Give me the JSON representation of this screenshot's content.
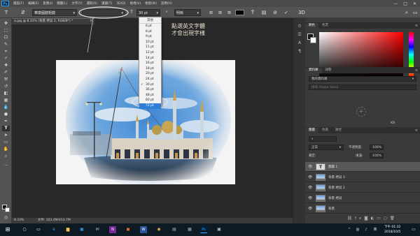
{
  "menubar": {
    "items": [
      "檔案(F)",
      "編輯(E)",
      "影像(I)",
      "圖層(L)",
      "文字(Y)",
      "選取(S)",
      "濾鏡(T)",
      "3D(D)",
      "檢視(V)",
      "視窗(W)",
      "說明(H)"
    ],
    "window_controls": [
      "—",
      "□",
      "✕"
    ]
  },
  "options_bar": {
    "font_family": "華康圓體粗體",
    "font_size": "30 pt",
    "aa_mode": "明晰",
    "text_color": "#000000"
  },
  "document": {
    "tab_title": "a.jpg @ 8.33% (背景 拷貝 2, RGB/8*) *",
    "zoom": "8.33%",
    "doc_info": "文件: 103.4M/413.7M"
  },
  "annotation": {
    "line1": "點選英文字體",
    "line2": "才會出現字樣"
  },
  "size_dropdown": {
    "header": "其他",
    "options": [
      "6 pt",
      "8 pt",
      "9 pt",
      "10 pt",
      "11 pt",
      "12 pt",
      "14 pt",
      "16 pt",
      "18 pt",
      "20 pt",
      "24 pt",
      "30 pt",
      "36 pt",
      "48 pt",
      "60 pt",
      "72 pt"
    ],
    "checked": "30 pt",
    "highlighted": "72 pt"
  },
  "panels": {
    "color_tabs": [
      "顏色",
      "色票"
    ],
    "library_tabs": [
      "資料庫",
      "調整"
    ],
    "library_dropdown": "我的資料庫",
    "library_search": "搜尋 Adobe Stock",
    "library_size": "KB",
    "layers_tabs": [
      "圖層",
      "色版",
      "路徑"
    ],
    "blend_mode": "正常",
    "opacity_label": "不透明度:",
    "opacity_value": "100%",
    "lock_label": "鎖定:",
    "fill_label": "填滿:",
    "fill_value": "100%"
  },
  "layers": [
    {
      "name": "圖層 1",
      "kind": "type"
    },
    {
      "name": "背景 拷貝 3",
      "kind": "image"
    },
    {
      "name": "背景 拷貝 2",
      "kind": "image"
    },
    {
      "name": "背景 拷貝",
      "kind": "image"
    },
    {
      "name": "背景",
      "kind": "image"
    }
  ],
  "taskbar": {
    "ime": "英",
    "time": "下午 01:32",
    "date": "2018/10/5"
  },
  "colors": {
    "accent_highlight": "#2f7fd6",
    "annotation_ring": "#e6e6e6"
  }
}
